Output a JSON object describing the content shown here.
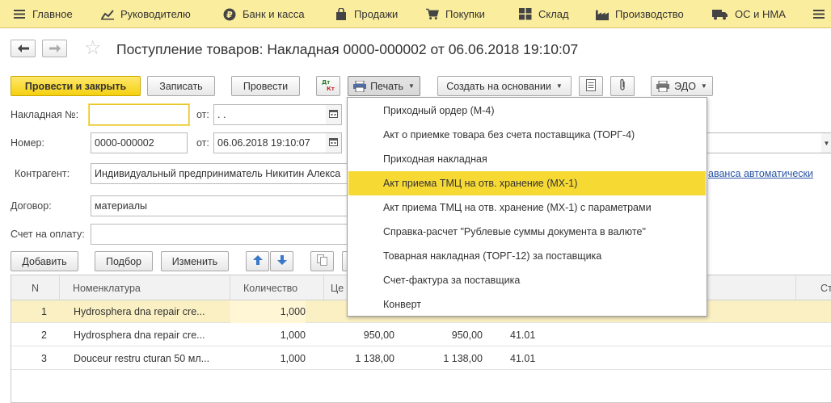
{
  "sections": [
    {
      "label": "Главное",
      "icon": "menu-icon"
    },
    {
      "label": "Руководителю",
      "icon": "chart-icon"
    },
    {
      "label": "Банк и касса",
      "icon": "ruble-icon"
    },
    {
      "label": "Продажи",
      "icon": "bag-icon"
    },
    {
      "label": "Покупки",
      "icon": "cart-icon"
    },
    {
      "label": "Склад",
      "icon": "warehouse-icon"
    },
    {
      "label": "Производство",
      "icon": "factory-icon"
    },
    {
      "label": "ОС и НМА",
      "icon": "truck-icon"
    }
  ],
  "document": {
    "title": "Поступление товаров: Накладная 0000-000002 от 06.06.2018 19:10:07"
  },
  "toolbar": {
    "post_close": "Провести и закрыть",
    "save": "Записать",
    "post": "Провести",
    "print": "Печать",
    "create_based": "Создать на основании",
    "edo": "ЭДО"
  },
  "form": {
    "invoice_label": "Накладная №:",
    "invoice_value": "",
    "from_label": "от:",
    "invoice_date": " .  .",
    "number_label": "Номер:",
    "number_value": "0000-000002",
    "date_value": "06.06.2018 19:10:07",
    "counterparty_label": "Контрагент:",
    "counterparty_value": "Индивидуальный предприниматель Никитин Алекса",
    "contract_label": "Договор:",
    "contract_value": "материалы",
    "payment_label": "Счет на оплату:",
    "payment_value": "",
    "advance_link": "аванса автоматически"
  },
  "table_toolbar": {
    "add": "Добавить",
    "pick": "Подбор",
    "change": "Изменить"
  },
  "table": {
    "headers": [
      "N",
      "Номенклатура",
      "Количество",
      "Це",
      "Стра"
    ],
    "rows": [
      {
        "n": "1",
        "name": "Hydrosphera dna repair cre...",
        "qty": "1,000",
        "price": "",
        "sum": "",
        "account": ""
      },
      {
        "n": "2",
        "name": "Hydrosphera dna repair cre...",
        "qty": "1,000",
        "price": "950,00",
        "sum": "950,00",
        "account": "41.01"
      },
      {
        "n": "3",
        "name": "Douceur restru cturan 50 мл...",
        "qty": "1,000",
        "price": "1 138,00",
        "sum": "1 138,00",
        "account": "41.01"
      }
    ]
  },
  "print_menu": {
    "items": [
      "Приходный ордер (М-4)",
      "Акт о приемке товара без счета поставщика (ТОРГ-4)",
      "Приходная накладная",
      "Акт приема ТМЦ на отв. хранение (МХ-1)",
      "Акт приема ТМЦ на отв. хранение (МХ-1) с параметрами",
      "Справка-расчет \"Рублевые суммы документа в валюте\"",
      "Товарная накладная (ТОРГ-12) за поставщика",
      "Счет-фактура за поставщика",
      "Конверт"
    ],
    "highlighted_index": 3
  },
  "colors": {
    "section_bar": "#fbed9e",
    "primary_button": "#f5d010",
    "menu_highlight": "#f7d934",
    "selected_row": "#fbf0c3",
    "link": "#2a54a5"
  }
}
